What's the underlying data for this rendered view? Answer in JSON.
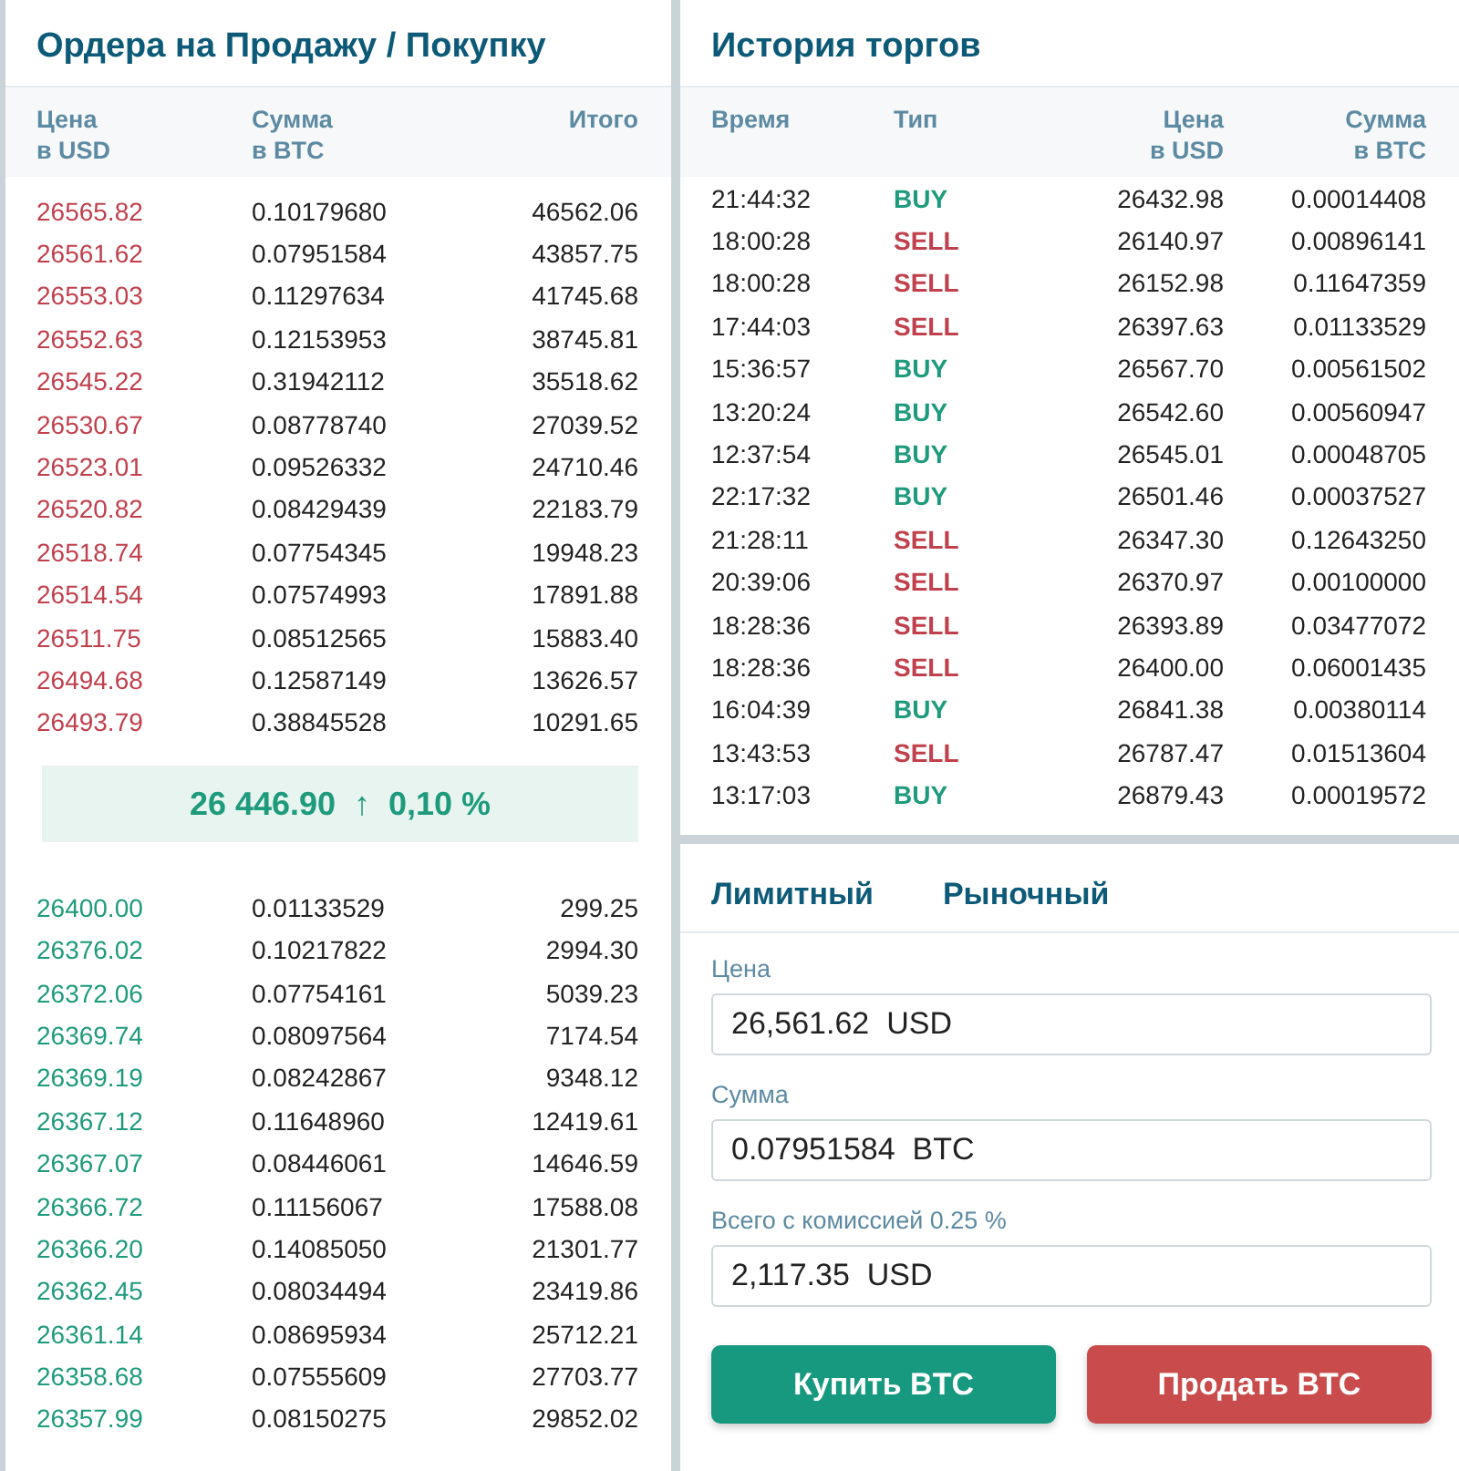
{
  "order_book": {
    "title": "Ордера на Продажу / Покупку",
    "columns": [
      "Цена\nв USD",
      "Сумма\nв BTC",
      "Итого"
    ],
    "asks": [
      [
        "26565.82",
        "0.10179680",
        "46562.06"
      ],
      [
        "26561.62",
        "0.07951584",
        "43857.75"
      ],
      [
        "26553.03",
        "0.11297634",
        "41745.68"
      ],
      [
        "26552.63",
        "0.12153953",
        "38745.81"
      ],
      [
        "26545.22",
        "0.31942112",
        "35518.62"
      ],
      [
        "26530.67",
        "0.08778740",
        "27039.52"
      ],
      [
        "26523.01",
        "0.09526332",
        "24710.46"
      ],
      [
        "26520.82",
        "0.08429439",
        "22183.79"
      ],
      [
        "26518.74",
        "0.07754345",
        "19948.23"
      ],
      [
        "26514.54",
        "0.07574993",
        "17891.88"
      ],
      [
        "26511.75",
        "0.08512565",
        "15883.40"
      ],
      [
        "26494.68",
        "0.12587149",
        "13626.57"
      ],
      [
        "26493.79",
        "0.38845528",
        "10291.65"
      ]
    ],
    "last_price": {
      "price": "26 446.90",
      "arrow": "↑",
      "change": "0,10 %"
    },
    "bids": [
      [
        "26400.00",
        "0.01133529",
        "299.25"
      ],
      [
        "26376.02",
        "0.10217822",
        "2994.30"
      ],
      [
        "26372.06",
        "0.07754161",
        "5039.23"
      ],
      [
        "26369.74",
        "0.08097564",
        "7174.54"
      ],
      [
        "26369.19",
        "0.08242867",
        "9348.12"
      ],
      [
        "26367.12",
        "0.11648960",
        "12419.61"
      ],
      [
        "26367.07",
        "0.08446061",
        "14646.59"
      ],
      [
        "26366.72",
        "0.11156067",
        "17588.08"
      ],
      [
        "26366.20",
        "0.14085050",
        "21301.77"
      ],
      [
        "26362.45",
        "0.08034494",
        "23419.86"
      ],
      [
        "26361.14",
        "0.08695934",
        "25712.21"
      ],
      [
        "26358.68",
        "0.07555609",
        "27703.77"
      ],
      [
        "26357.99",
        "0.08150275",
        "29852.02"
      ]
    ]
  },
  "trade_history": {
    "title": "История торгов",
    "columns": [
      "Время",
      "Тип",
      "Цена\nв USD",
      "Сумма\nв BTC"
    ],
    "rows": [
      {
        "time": "21:44:32",
        "kind": "buy",
        "type": "BUY",
        "price": "26432.98",
        "amount": "0.00014408"
      },
      {
        "time": "18:00:28",
        "kind": "sell",
        "type": "SELL",
        "price": "26140.97",
        "amount": "0.00896141"
      },
      {
        "time": "18:00:28",
        "kind": "sell",
        "type": "SELL",
        "price": "26152.98",
        "amount": "0.11647359"
      },
      {
        "time": "17:44:03",
        "kind": "sell",
        "type": "SELL",
        "price": "26397.63",
        "amount": "0.01133529"
      },
      {
        "time": "15:36:57",
        "kind": "buy",
        "type": "BUY",
        "price": "26567.70",
        "amount": "0.00561502"
      },
      {
        "time": "13:20:24",
        "kind": "buy",
        "type": "BUY",
        "price": "26542.60",
        "amount": "0.00560947"
      },
      {
        "time": "12:37:54",
        "kind": "buy",
        "type": "BUY",
        "price": "26545.01",
        "amount": "0.00048705"
      },
      {
        "time": "22:17:32",
        "kind": "buy",
        "type": "BUY",
        "price": "26501.46",
        "amount": "0.00037527"
      },
      {
        "time": "21:28:11",
        "kind": "sell",
        "type": "SELL",
        "price": "26347.30",
        "amount": "0.12643250"
      },
      {
        "time": "20:39:06",
        "kind": "sell",
        "type": "SELL",
        "price": "26370.97",
        "amount": "0.00100000"
      },
      {
        "time": "18:28:36",
        "kind": "sell",
        "type": "SELL",
        "price": "26393.89",
        "amount": "0.03477072"
      },
      {
        "time": "18:28:36",
        "kind": "sell",
        "type": "SELL",
        "price": "26400.00",
        "amount": "0.06001435"
      },
      {
        "time": "16:04:39",
        "kind": "buy",
        "type": "BUY",
        "price": "26841.38",
        "amount": "0.00380114"
      },
      {
        "time": "13:43:53",
        "kind": "sell",
        "type": "SELL",
        "price": "26787.47",
        "amount": "0.01513604"
      },
      {
        "time": "13:17:03",
        "kind": "buy",
        "type": "BUY",
        "price": "26879.43",
        "amount": "0.00019572"
      }
    ]
  },
  "order_form": {
    "tabs": [
      "Лимитный",
      "Рыночный"
    ],
    "fields": [
      {
        "label": "Цена",
        "value": "26,561.62  USD"
      },
      {
        "label": "Сумма",
        "value": "0.07951584  BTC"
      },
      {
        "label": "Всего с комиссией 0.25 %",
        "value": "2,117.35  USD"
      }
    ],
    "buttons": [
      {
        "kind": "buy",
        "label": "Купить BTC"
      },
      {
        "kind": "sell",
        "label": "Продать BTC"
      }
    ]
  }
}
